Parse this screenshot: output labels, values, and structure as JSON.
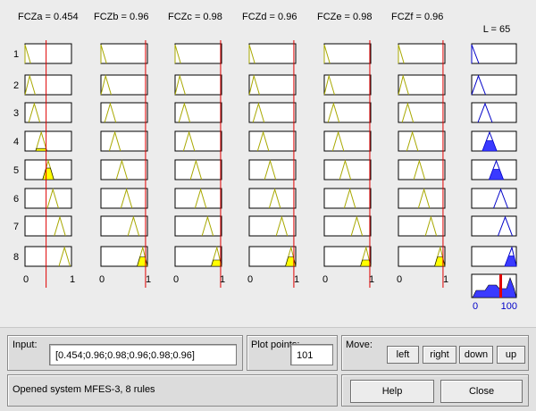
{
  "viewer": {
    "input_headers": [
      {
        "name": "FCZa",
        "value": 0.454,
        "label": "FCZa = 0.454"
      },
      {
        "name": "FCZb",
        "value": 0.96,
        "label": "FCZb = 0.96"
      },
      {
        "name": "FCZc",
        "value": 0.98,
        "label": "FCZc = 0.98"
      },
      {
        "name": "FCZd",
        "value": 0.96,
        "label": "FCZd = 0.96"
      },
      {
        "name": "FCZe",
        "value": 0.98,
        "label": "FCZe = 0.98"
      },
      {
        "name": "FCZf",
        "value": 0.96,
        "label": "FCZf = 0.96"
      }
    ],
    "output_header": "L = 65",
    "output_value": 65,
    "rule_numbers": [
      "1",
      "2",
      "3",
      "4",
      "5",
      "6",
      "7",
      "8"
    ],
    "input_axis": {
      "min_label": "0",
      "max_label": "1",
      "min": 0,
      "max": 1
    },
    "output_axis": {
      "min_label": "0",
      "max_label": "100",
      "min": 0,
      "max": 100
    },
    "input_mf_centers": [
      [
        0.0,
        0.1,
        0.2,
        0.35,
        0.5,
        0.6,
        0.75,
        0.85
      ],
      [
        0.0,
        0.1,
        0.2,
        0.3,
        0.45,
        0.55,
        0.7,
        0.9
      ],
      [
        0.0,
        0.1,
        0.2,
        0.3,
        0.45,
        0.55,
        0.7,
        0.9
      ],
      [
        0.0,
        0.1,
        0.2,
        0.3,
        0.45,
        0.55,
        0.7,
        0.9
      ],
      [
        0.0,
        0.1,
        0.2,
        0.3,
        0.45,
        0.55,
        0.7,
        0.9
      ],
      [
        0.0,
        0.1,
        0.2,
        0.3,
        0.45,
        0.55,
        0.7,
        0.9
      ]
    ],
    "output_mf_centers": [
      0,
      15,
      30,
      40,
      55,
      65,
      75,
      90
    ],
    "colors": {
      "mf_line": "#a8a800",
      "mf_fill": "#ffff00",
      "out_line": "#0000c8",
      "out_fill": "#3a3aff",
      "index_line": "#e00000",
      "axis_text": "#0000c8"
    }
  },
  "controls": {
    "input_label": "Input:",
    "input_value": "[0.454;0.96;0.98;0.96;0.98;0.96]",
    "plot_points_label": "Plot points:",
    "plot_points_value": "101",
    "move_label": "Move:",
    "buttons": {
      "left": "left",
      "right": "right",
      "down": "down",
      "up": "up",
      "help": "Help",
      "close": "Close"
    },
    "status": "Opened system MFES-3, 8 rules"
  }
}
